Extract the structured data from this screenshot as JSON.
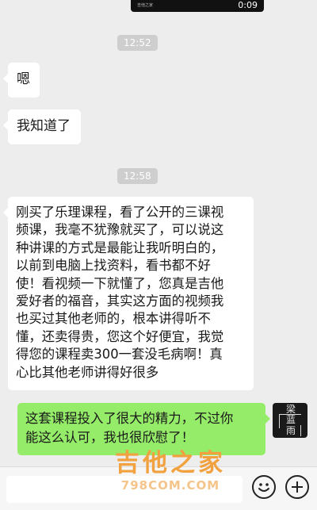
{
  "video": {
    "source_label": "吉他之家",
    "duration": "0:09"
  },
  "timestamps": [
    "12:52",
    "12:58"
  ],
  "messages": {
    "m1": "嗯",
    "m2": "我知道了",
    "m3_lines": [
      "刚买了乐理课程，看了公开的三课视",
      "频课，我毫不犹豫就买了，可以说这",
      "种讲课的方式是最能让我听明白的，",
      "以前到电脑上找资料，看书都不好",
      "使！看视频一下就懂了，您真是吉他",
      "爱好者的福音，其实这方面的视频我",
      "也买过其他老师的，根本讲得听不",
      "懂，还卖得贵，您这个好便宜，我觉",
      "得您的课程卖300一套没毛病啊！真",
      "心比其他老师讲得好很多"
    ],
    "m4_lines": [
      "这套课程投入了很大的精力，不过你",
      "能这么认可，我也很欣慰了！"
    ]
  },
  "avatar": {
    "chars": [
      "梁",
      "蓝",
      "雨"
    ]
  },
  "watermark": {
    "title": "吉他之家",
    "url": "798COM.COM"
  },
  "colors": {
    "background": "#ededed",
    "sent_bubble": "#95ec69",
    "received_bubble": "#ffffff",
    "watermark": "#f2a13f"
  },
  "icons": {
    "emoji": "emoji-icon",
    "plus": "plus-icon"
  }
}
